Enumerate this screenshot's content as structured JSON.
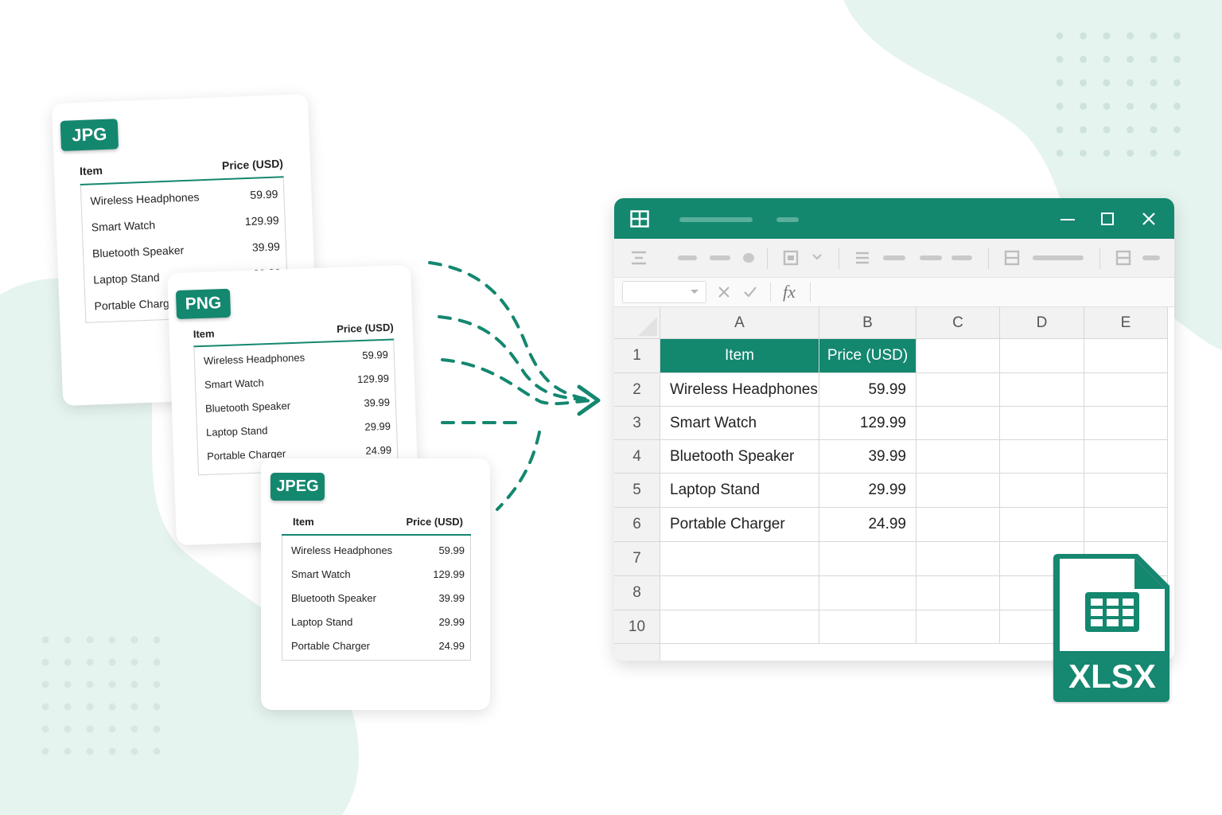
{
  "colors": {
    "accent": "#14876f",
    "accent_light": "#e6f4f0"
  },
  "cards": {
    "jpg": {
      "badge": "JPG",
      "header_item": "Item",
      "header_price": "Price (USD)",
      "rows": [
        {
          "item": "Wireless Headphones",
          "price": "59.99"
        },
        {
          "item": "Smart Watch",
          "price": "129.99"
        },
        {
          "item": "Bluetooth Speaker",
          "price": "39.99"
        },
        {
          "item": "Laptop Stand",
          "price": "29.99"
        },
        {
          "item": "Portable Charg",
          "price": ""
        }
      ]
    },
    "png": {
      "badge": "PNG",
      "header_item": "Item",
      "header_price": "Price (USD)",
      "rows": [
        {
          "item": "Wireless Headphones",
          "price": "59.99"
        },
        {
          "item": "Smart Watch",
          "price": "129.99"
        },
        {
          "item": "Bluetooth Speaker",
          "price": "39.99"
        },
        {
          "item": "Laptop Stand",
          "price": "29.99"
        },
        {
          "item": "Portable Charger",
          "price": "24.99"
        }
      ]
    },
    "jpeg": {
      "badge": "JPEG",
      "header_item": "Item",
      "header_price": "Price (USD)",
      "rows": [
        {
          "item": "Wireless Headphones",
          "price": "59.99"
        },
        {
          "item": "Smart Watch",
          "price": "129.99"
        },
        {
          "item": "Bluetooth Speaker",
          "price": "39.99"
        },
        {
          "item": "Laptop Stand",
          "price": "29.99"
        },
        {
          "item": "Portable Charger",
          "price": "24.99"
        }
      ]
    }
  },
  "excel": {
    "formula_label": "fx",
    "columns": [
      "A",
      "B",
      "C",
      "D",
      "E"
    ],
    "row_numbers": [
      "1",
      "2",
      "3",
      "4",
      "5",
      "6",
      "7",
      "8",
      "10"
    ],
    "header": {
      "a": "Item",
      "b": "Price (USD)"
    },
    "rows": [
      {
        "a": "Wireless Headphones",
        "b": "59.99"
      },
      {
        "a": "Smart Watch",
        "b": "129.99"
      },
      {
        "a": "Bluetooth Speaker",
        "b": "39.99"
      },
      {
        "a": "Laptop Stand",
        "b": "29.99"
      },
      {
        "a": "Portable Charger",
        "b": "24.99"
      }
    ]
  },
  "file_icon": {
    "label": "XLSX"
  },
  "icons": [
    "grid-app-icon",
    "minimize-icon",
    "maximize-icon",
    "close-icon",
    "cancel-x-icon",
    "confirm-check-icon",
    "dropdown-arrow-icon",
    "arrow-right-icon",
    "spreadsheet-icon"
  ]
}
